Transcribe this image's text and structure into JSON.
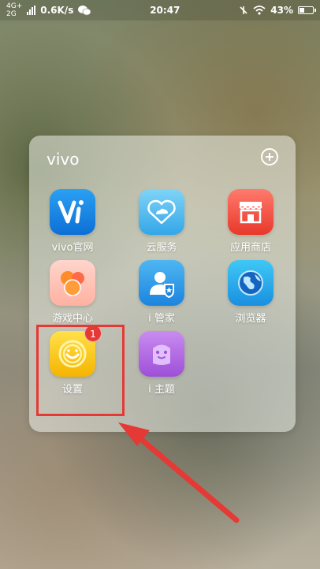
{
  "status_bar": {
    "network_top": "4G+",
    "network_bottom": "2G",
    "speed": "0.6K/s",
    "time": "20:47",
    "battery": "43%",
    "battery_level": 0.43
  },
  "folder": {
    "title": "vivo",
    "apps": [
      {
        "label": "vivo官网",
        "icon": "vivo-website-icon"
      },
      {
        "label": "云服务",
        "icon": "cloud-service-icon"
      },
      {
        "label": "应用商店",
        "icon": "app-store-icon"
      },
      {
        "label": "游戏中心",
        "icon": "game-center-icon"
      },
      {
        "label": "i 管家",
        "icon": "i-manager-icon"
      },
      {
        "label": "浏览器",
        "icon": "browser-icon"
      },
      {
        "label": "设置",
        "icon": "settings-icon",
        "badge": "1"
      },
      {
        "label": "i 主题",
        "icon": "i-theme-icon"
      }
    ]
  },
  "colors": {
    "highlight": "#e53935",
    "badge": "#e53935"
  }
}
